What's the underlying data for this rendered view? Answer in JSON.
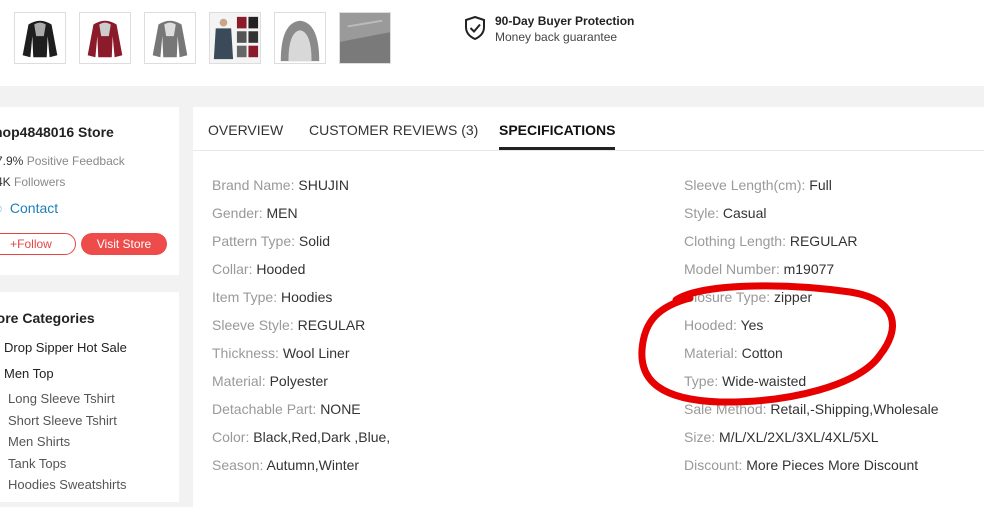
{
  "protection": {
    "title": "90-Day Buyer Protection",
    "subtitle": "Money back guarantee"
  },
  "thumbnails": [
    {
      "name": "black-hoodie-thumbnail"
    },
    {
      "name": "red-hoodie-thumbnail"
    },
    {
      "name": "gray-hoodie-thumbnail"
    },
    {
      "name": "model-hoodie-collage-thumbnail"
    },
    {
      "name": "hood-detail-thumbnail"
    },
    {
      "name": "fabric-detail-thumbnail"
    }
  ],
  "store": {
    "name": "hop4848016 Store",
    "feedback_value": "7.9%",
    "feedback_label": "Positive Feedback",
    "followers_value": "4K",
    "followers_label": "Followers",
    "contact": "Contact",
    "follow_label": "+Follow",
    "visit_label": "Visit Store"
  },
  "categories": {
    "title": "tore Categories",
    "items": [
      {
        "label": "Drop Sipper Hot Sale",
        "level": "main"
      },
      {
        "label": "Men Top",
        "level": "main"
      },
      {
        "label": "Long Sleeve Tshirt",
        "level": "sub"
      },
      {
        "label": "Short Sleeve Tshirt",
        "level": "sub"
      },
      {
        "label": "Men Shirts",
        "level": "sub"
      },
      {
        "label": "Tank Tops",
        "level": "sub"
      },
      {
        "label": "Hoodies Sweatshirts",
        "level": "sub"
      }
    ]
  },
  "tabs": [
    {
      "label": "OVERVIEW",
      "active": false
    },
    {
      "label": "CUSTOMER REVIEWS (3)",
      "active": false
    },
    {
      "label": "SPECIFICATIONS",
      "active": true
    }
  ],
  "specs_left": [
    {
      "key": "Brand Name:",
      "value": "SHUJIN"
    },
    {
      "key": "Gender:",
      "value": "MEN"
    },
    {
      "key": "Pattern Type:",
      "value": "Solid"
    },
    {
      "key": "Collar:",
      "value": "Hooded"
    },
    {
      "key": "Item Type:",
      "value": "Hoodies"
    },
    {
      "key": "Sleeve Style:",
      "value": "REGULAR"
    },
    {
      "key": "Thickness:",
      "value": "Wool Liner"
    },
    {
      "key": "Material:",
      "value": "Polyester"
    },
    {
      "key": "Detachable Part:",
      "value": "NONE"
    },
    {
      "key": "Color:",
      "value": "Black,Red,Dark ,Blue,"
    },
    {
      "key": "Season:",
      "value": "Autumn,Winter"
    }
  ],
  "specs_right": [
    {
      "key": "Sleeve Length(cm):",
      "value": "Full"
    },
    {
      "key": "Style:",
      "value": "Casual"
    },
    {
      "key": "Clothing Length:",
      "value": "REGULAR"
    },
    {
      "key": "Model Number:",
      "value": "m19077"
    },
    {
      "key": "Closure Type:",
      "value": "zipper"
    },
    {
      "key": "Hooded:",
      "value": "Yes"
    },
    {
      "key": "Material:",
      "value": "Cotton"
    },
    {
      "key": "Type:",
      "value": "Wide-waisted"
    },
    {
      "key": "Sale Method:",
      "value": "Retail,-Shipping,Wholesale"
    },
    {
      "key": "Size:",
      "value": "M/L/XL/2XL/3XL/4XL/5XL"
    },
    {
      "key": "Discount:",
      "value": "More Pieces More Discount"
    }
  ],
  "colors": {
    "accent_red": "#ee4b4b",
    "link_blue": "#1e7fb8",
    "annotation_red": "#e60000"
  }
}
